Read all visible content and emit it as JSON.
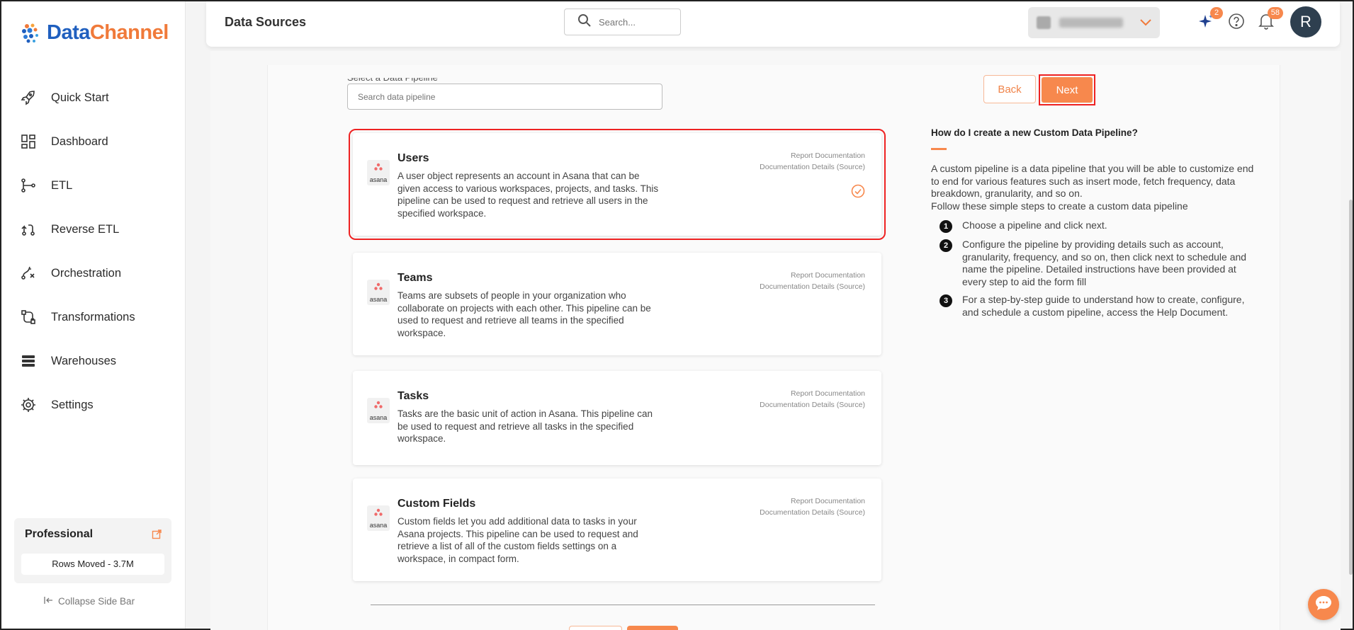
{
  "brand": {
    "name_part1": "Data",
    "name_part2": "Channel"
  },
  "sidebar": {
    "items": [
      {
        "label": "Quick Start",
        "icon": "rocket-icon"
      },
      {
        "label": "Dashboard",
        "icon": "dashboard-icon"
      },
      {
        "label": "ETL",
        "icon": "etl-icon"
      },
      {
        "label": "Reverse ETL",
        "icon": "reverse-etl-icon"
      },
      {
        "label": "Orchestration",
        "icon": "orchestration-icon"
      },
      {
        "label": "Transformations",
        "icon": "transformations-icon"
      },
      {
        "label": "Warehouses",
        "icon": "warehouses-icon"
      },
      {
        "label": "Settings",
        "icon": "gear-icon"
      }
    ],
    "plan": {
      "name": "Professional",
      "rows_moved": "Rows Moved - 3.7M"
    },
    "collapse_label": "Collapse Side Bar"
  },
  "header": {
    "title": "Data Sources",
    "search_placeholder": "Search...",
    "ai_badge": "2",
    "notifications_badge": "58",
    "avatar_letter": "R"
  },
  "pipeline": {
    "section_label": "Select a Data Pipeline",
    "search_placeholder": "Search data pipeline",
    "back_label": "Back",
    "next_label": "Next",
    "cards": [
      {
        "title": "Users",
        "description": "A user object represents an account in Asana that can be given access to various workspaces, projects, and tasks. This pipeline can be used to request and retrieve all users in the specified workspace.",
        "link1": "Report Documentation",
        "link2": "Documentation Details (Source)",
        "logo_text": "asana",
        "selected": true
      },
      {
        "title": "Teams",
        "description": "Teams are subsets of people in your organization who collaborate on projects with each other. This pipeline can be used to request and retrieve all teams in the specified workspace.",
        "link1": "Report Documentation",
        "link2": "Documentation Details (Source)",
        "logo_text": "asana",
        "selected": false
      },
      {
        "title": "Tasks",
        "description": "Tasks are the basic unit of action in Asana. This pipeline can be used to request and retrieve all tasks in the specified workspace.",
        "link1": "Report Documentation",
        "link2": "Documentation Details (Source)",
        "logo_text": "asana",
        "selected": false
      },
      {
        "title": "Custom Fields",
        "description": "Custom fields let you add additional data to tasks in your Asana projects. This pipeline can be used to request and retrieve a list of all of the custom fields settings on a workspace, in compact form.",
        "link1": "Report Documentation",
        "link2": "Documentation Details (Source)",
        "logo_text": "asana",
        "selected": false
      }
    ]
  },
  "help": {
    "title": "How do I create a new Custom Data Pipeline?",
    "intro": "A custom pipeline is a data pipeline that you will be able to customize end to end for various features such as insert mode, fetch frequency, data breakdown, granularity, and so on.",
    "intro2": "Follow these simple steps to create a custom data pipeline",
    "steps": [
      {
        "num": "1",
        "text": "Choose a pipeline and click next."
      },
      {
        "num": "2",
        "text": "Configure the pipeline by providing details such as account, granularity, frequency, and so on, then click next to schedule and name the pipeline. Detailed instructions have been provided at every step to aid the form fill"
      },
      {
        "num": "3",
        "text": "For a step-by-step guide to understand how to create, configure, and schedule a custom pipeline, access the Help Document."
      }
    ]
  },
  "colors": {
    "accent": "#f7884d",
    "brand_blue": "#1f5fbf",
    "highlight": "#ee2222"
  }
}
